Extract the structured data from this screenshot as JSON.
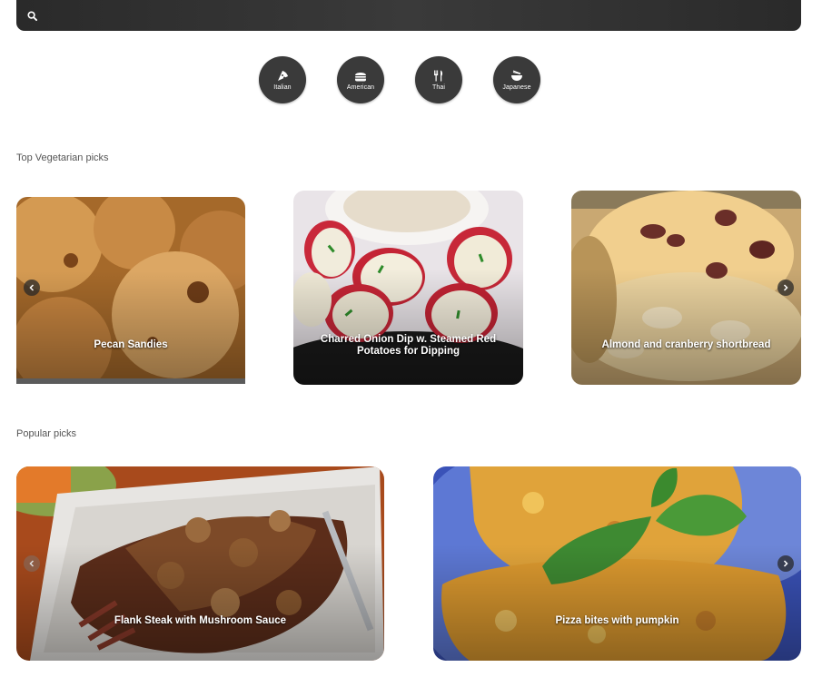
{
  "search": {
    "placeholder": "",
    "value": ""
  },
  "cuisines": [
    {
      "label": "Italian",
      "icon": "pizza-icon"
    },
    {
      "label": "American",
      "icon": "burger-icon"
    },
    {
      "label": "Thai",
      "icon": "utensils-icon"
    },
    {
      "label": "Japanese",
      "icon": "ramen-bowl-icon"
    }
  ],
  "sections": {
    "vegetarian": {
      "title": "Top Vegetarian picks",
      "cards": [
        {
          "title": "Pecan Sandies"
        },
        {
          "title": "Charred Onion Dip w. Steamed Red Potatoes for Dipping"
        },
        {
          "title": "Almond and cranberry shortbread"
        }
      ]
    },
    "popular": {
      "title": "Popular picks",
      "cards": [
        {
          "title": "Flank Steak with Mushroom Sauce"
        },
        {
          "title": "Pizza bites with pumpkin"
        }
      ]
    }
  },
  "colors": {
    "search_bar": "#333333",
    "cuisine_button": "#3a3a3a",
    "accent_text": "#ffffff"
  }
}
